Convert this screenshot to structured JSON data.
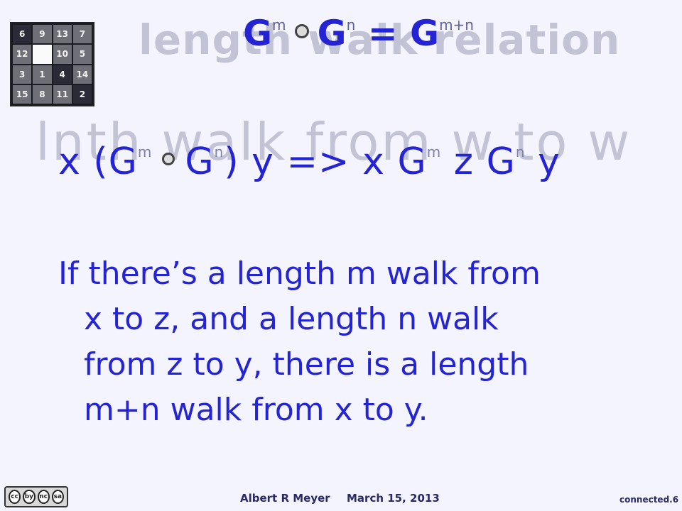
{
  "puzzle": {
    "tiles": [
      "6",
      "9",
      "13",
      "7",
      "12",
      "",
      "10",
      "5",
      "3",
      "1",
      "4",
      "14",
      "15",
      "8",
      "11",
      "2"
    ]
  },
  "titles": {
    "ghost_title": "length  walk relation",
    "ghost_subtitle": "lnth  walk from w to w"
  },
  "formula": {
    "left": "G",
    "left_exp": "m",
    "right": "G",
    "right_exp": "n",
    "equals": "=",
    "result": "G",
    "result_exp": "m+n"
  },
  "relation": {
    "lhs_open": "x (G",
    "lhs_exp_m": "m",
    "lhs_mid": "G",
    "lhs_exp_n": "n",
    "lhs_close": ") y",
    "implies": "=>",
    "rhs_x": "x G",
    "rhs_exp_m": "m",
    "rhs_z": "z G",
    "rhs_exp_n": "n",
    "rhs_y": "y"
  },
  "paragraph": {
    "line1": "If there’s a length m walk from",
    "line2": "x to z, and a length  n walk",
    "line3": "from z to y, there is a length",
    "line4": "m+n walk from x to y."
  },
  "footer": {
    "license_icons": [
      "cc",
      "by",
      "nc",
      "sa"
    ],
    "author": "Albert R Meyer",
    "date": "March 15, 2013",
    "slide_id": "connected.6"
  }
}
